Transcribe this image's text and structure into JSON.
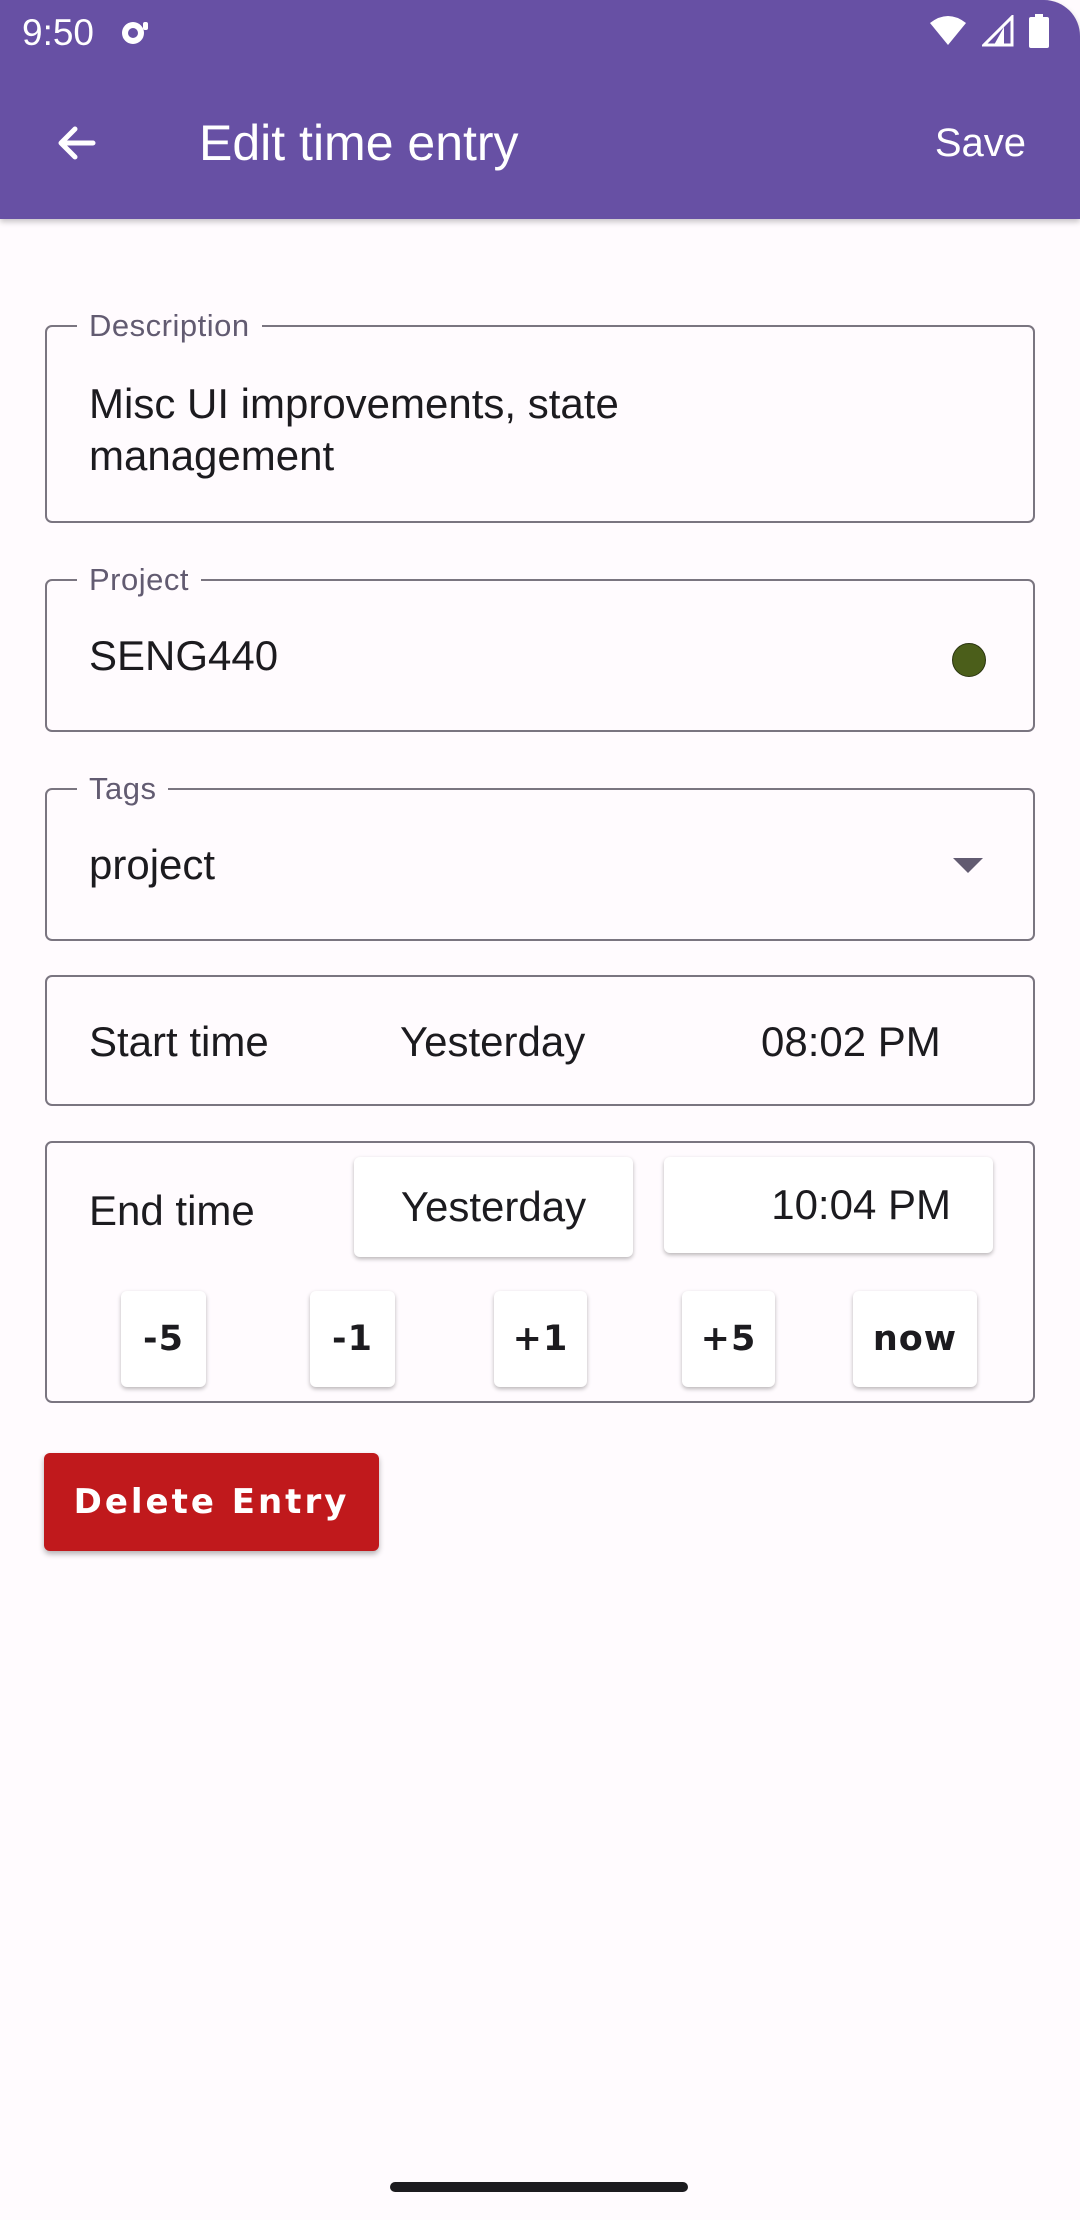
{
  "status_bar": {
    "time": "9:50",
    "icons": [
      "notification-icon",
      "wifi-icon",
      "signal-icon",
      "battery-icon"
    ]
  },
  "app_bar": {
    "title": "Edit time entry",
    "back_icon": "arrow-back-icon",
    "save_label": "Save"
  },
  "form": {
    "description": {
      "label": "Description",
      "value": "Misc UI improvements, state management"
    },
    "project": {
      "label": "Project",
      "value": "SENG440",
      "color": "#4b5e1a"
    },
    "tags": {
      "label": "Tags",
      "value": "project",
      "icon": "dropdown-arrow-icon"
    },
    "start_time": {
      "label": "Start time",
      "day": "Yesterday",
      "time": "08:02 PM"
    },
    "end_time": {
      "label": "End time",
      "day": "Yesterday",
      "time": "10:04 PM",
      "adjust_buttons": [
        "-5",
        "-1",
        "+1",
        "+5",
        "now"
      ]
    }
  },
  "delete_label": "Delete Entry",
  "colors": {
    "app_bar": "#6750a4",
    "delete": "#c0191c",
    "background": "#fffbfe"
  }
}
